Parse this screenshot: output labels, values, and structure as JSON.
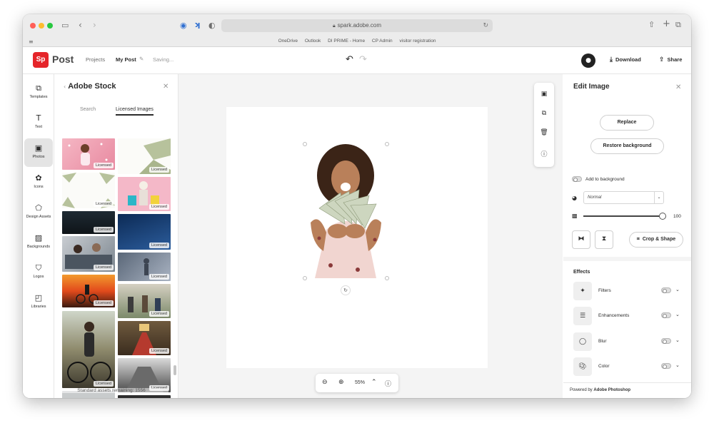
{
  "browser": {
    "url": "spark.adobe.com",
    "bookmarks": [
      "OneDrive",
      "Outlook",
      "DI PRIME - Home",
      "CP Admin",
      "visitor registration"
    ]
  },
  "header": {
    "logo_text": "Sp",
    "app_name": "Post",
    "breadcrumb_projects": "Projects",
    "breadcrumb_current": "My Post",
    "status": "Saving...",
    "download_label": "Download",
    "share_label": "Share"
  },
  "rail": {
    "items": [
      {
        "label": "Templates",
        "icon": "templates-icon"
      },
      {
        "label": "Text",
        "icon": "text-icon"
      },
      {
        "label": "Photos",
        "icon": "photos-icon",
        "active": true
      },
      {
        "label": "Icons",
        "icon": "icons-icon"
      },
      {
        "label": "Design Assets",
        "icon": "design-assets-icon"
      },
      {
        "label": "Backgrounds",
        "icon": "backgrounds-icon"
      },
      {
        "label": "Logos",
        "icon": "logos-icon"
      },
      {
        "label": "Libraries",
        "icon": "libraries-icon"
      }
    ]
  },
  "stock": {
    "title": "Adobe Stock",
    "tabs": [
      "Search",
      "Licensed Images"
    ],
    "active_tab": "Licensed Images",
    "badge": "Licensed",
    "remaining": "Standard assets remaining: 1556"
  },
  "canvas": {
    "zoom": "55%"
  },
  "edit": {
    "title": "Edit Image",
    "replace_label": "Replace",
    "restore_label": "Restore background",
    "add_to_background_label": "Add to background",
    "blend_mode": "Normal",
    "opacity": "100",
    "crop_label": "Crop & Shape",
    "effects_title": "Effects",
    "effects": [
      {
        "label": "Filters",
        "icon": "filters-icon"
      },
      {
        "label": "Enhancements",
        "icon": "enhancements-icon"
      },
      {
        "label": "Blur",
        "icon": "blur-icon"
      },
      {
        "label": "Color",
        "icon": "color-icon"
      }
    ],
    "footer_prefix": "Powered by",
    "footer_brand": "Adobe Photoshop"
  },
  "colors": {
    "brand": "#e5252a",
    "active_rail": "#e4e4e4",
    "canvas_bg": "#f4f4f4"
  }
}
